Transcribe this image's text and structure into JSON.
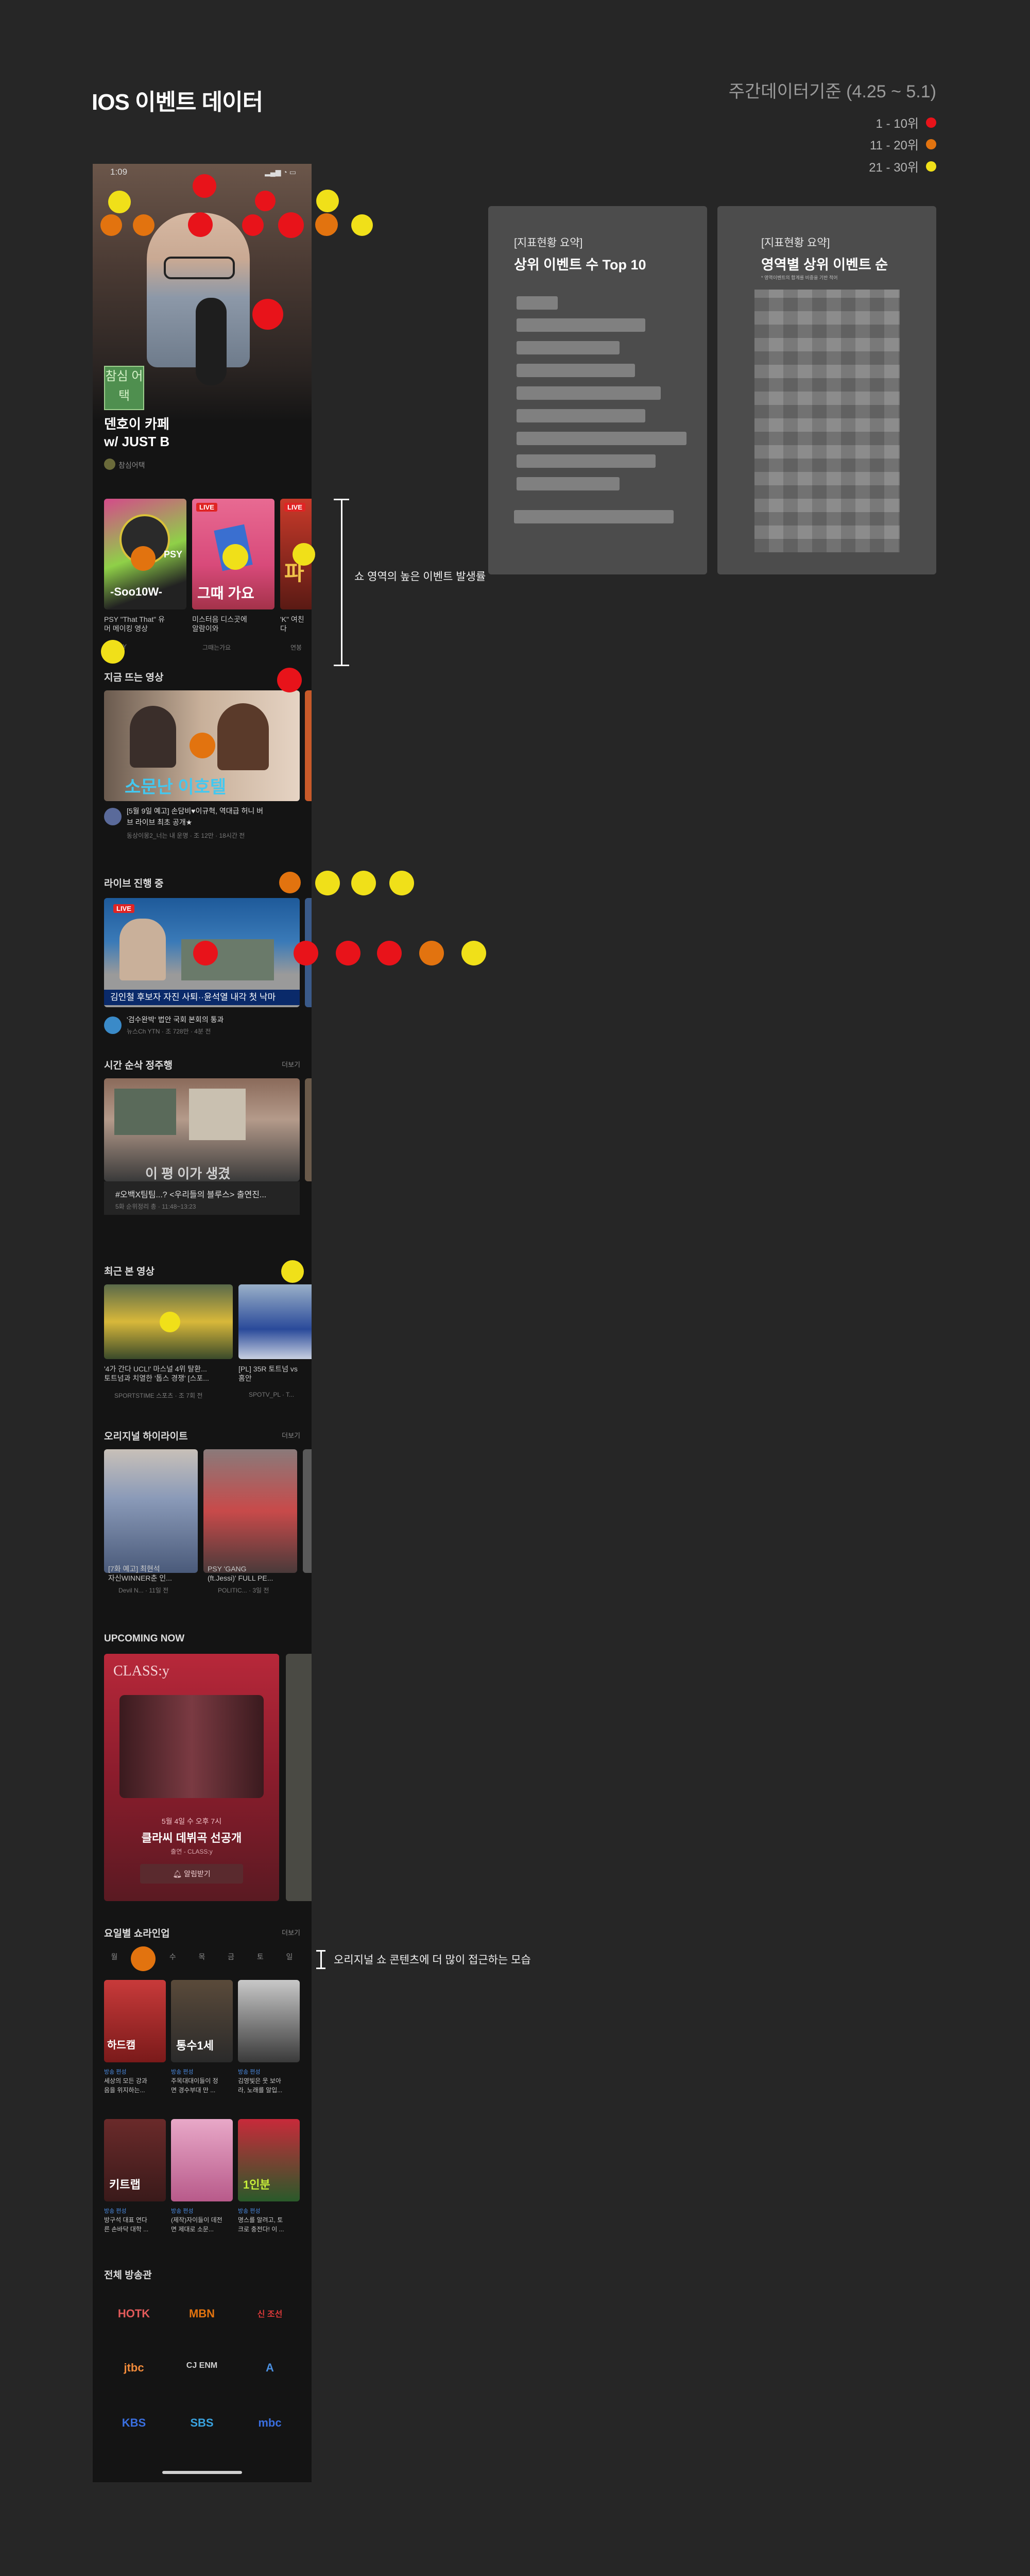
{
  "page": {
    "title": "IOS 이벤트 데이터",
    "period": "주간데이터기준 (4.25 ~ 5.1)",
    "legend": [
      {
        "label": "1 - 10위",
        "color": "#e8131a"
      },
      {
        "label": "11 - 20위",
        "color": "#e2730f"
      },
      {
        "label": "21 - 30위",
        "color": "#f0e019"
      }
    ]
  },
  "phone": {
    "status_time": "1:09",
    "hero": {
      "badge": "참심 어택",
      "title_line1": "덴호이 카페",
      "title_line2": "w/ JUST B",
      "channel": "참심어택"
    },
    "shorts": [
      {
        "caption": "PSY \"That That\" 유\n머 메이킹 영상",
        "channel": "PSY",
        "live": "",
        "thumb_text": "-Soo10W-",
        "tag": "PSY"
      },
      {
        "caption": "미스터음 디스곳에\n알람이와",
        "channel": "그때는가요",
        "live": "LIVE",
        "thumb_text": "그때 가요",
        "tag": ""
      },
      {
        "caption": "'K\" 여친\n다",
        "channel": "연봉",
        "live": "LIVE",
        "thumb_text": "파",
        "tag": ""
      }
    ],
    "hot": {
      "heading": "지금 뜨는 영상",
      "thumb_text": "소문난 이호텔",
      "caption": "[5월 9일 예고] 손담비♥이규혁, 역대급 허니 버\n브 라이브 최초 공개★",
      "meta": "동상이몽2_너는 내 운명 · 조 12만 · 18시간 전"
    },
    "live": {
      "heading": "라이브 진행 중",
      "tag": "LIVE",
      "news_ticker": "김인철 후보자 자진 사퇴··윤석열 내각 첫 낙마",
      "caption": "'검수완박' 법안 국회 본회의 통과",
      "meta": "뉴스Ch YTN · 조 728만 · 4분 전"
    },
    "timeline": {
      "heading": "시간 순삭 정주행",
      "more": "더보기",
      "thumb_text": "이 평 이가 생겼",
      "caption": "#오백X팀팀...? <우리들의 블루스> 출연진...",
      "meta": "5화 순위정리 총 · 11:48~13:23"
    },
    "recent": {
      "heading": "최근 본 영상",
      "items": [
        {
          "caption": "'4가 간다 UCL!' 마스널 4위 탈환...\n토트넘과 치열한 '톱스 경쟁' [스포...",
          "meta": "SPORTSTIME 스포츠 · 조 7회 전"
        },
        {
          "caption": "[PL] 35R 토트넘 vs\n홈안",
          "meta": "SPOTV_PL · T..."
        }
      ]
    },
    "original": {
      "heading": "오리지널 하이라이트",
      "more": "더보기",
      "items": [
        {
          "caption": "[7화 예고] 최현석\n자신WINNER춘 인...",
          "meta": "Devil N... · 11일 전"
        },
        {
          "caption": "PSY 'GANG\n(ft.Jessi)' FULL PE...",
          "meta": "POLITIC... · 3일 전"
        }
      ]
    },
    "upcoming": {
      "heading": "UPCOMING NOW",
      "poster_text": "CLASS:y",
      "date": "5월 4일 수 오후 7시",
      "title": "클라씨 데뷔곡 선공개",
      "meta": "출연 - CLASS:y",
      "button": "알림받기"
    },
    "weekday": {
      "heading": "요일별 쇼라인업",
      "more": "더보기",
      "days": [
        "월",
        "화",
        "수",
        "목",
        "금",
        "토",
        "일"
      ],
      "active_index": 1,
      "row1": [
        {
          "label": "방송 편성",
          "caption": "세상의 모든 강과\n음을 위지하는...",
          "thumb_text": "하드캠"
        },
        {
          "label": "방송 편성",
          "caption": "주목대대이들이 정\n면 경수부대 만 ...",
          "thumb_text": "통수1세"
        },
        {
          "label": "방송 편성",
          "caption": "김영빛은 웃 보아\n라, 노래를 알입..."
        }
      ],
      "row2": [
        {
          "label": "방송 편성",
          "caption": "방구석 대표 연다\n른 손바닥 대학 ...",
          "thumb_text": "키트랩"
        },
        {
          "label": "방송 편성",
          "caption": "(제작)자이들이 데전\n면 제대로 소문..."
        },
        {
          "label": "방송 편성",
          "caption": "명스를 알려고, 토\n크로 충전다! 이 ...",
          "thumb_text": "1인분"
        }
      ]
    },
    "broadcasters": {
      "heading": "전체 방송관",
      "items": [
        {
          "name": "HOTK",
          "color": "#e25a5a"
        },
        {
          "name": "MBN",
          "color": "#e2730f"
        },
        {
          "name": "신 조선",
          "color": "#e03a3a"
        },
        {
          "name": "jtbc",
          "color": "#f08a3a"
        },
        {
          "name": "CJ ENM",
          "color": "#d0d0d0"
        },
        {
          "name": "A",
          "color": "#4a8fe0"
        },
        {
          "name": "KBS",
          "color": "#3a6fe0"
        },
        {
          "name": "SBS",
          "color": "#3aa3e0"
        },
        {
          "name": "mbc",
          "color": "#3a6fe0"
        }
      ]
    }
  },
  "annotations": {
    "short_area": "쇼 영역의 높은 이벤트 발생률",
    "original_show": "오리지널 쇼 콘텐츠에 더 많이 접근하는 모습"
  },
  "panels": [
    {
      "kicker": "[지표현황 요약]",
      "title": "상위 이벤트 수 Top 10",
      "note": ""
    },
    {
      "kicker": "[지표현황 요약]",
      "title": "영역별 상위 이벤트 순",
      "note": "* 영역이벤트의 합계를 비중을 기반 적어"
    }
  ]
}
